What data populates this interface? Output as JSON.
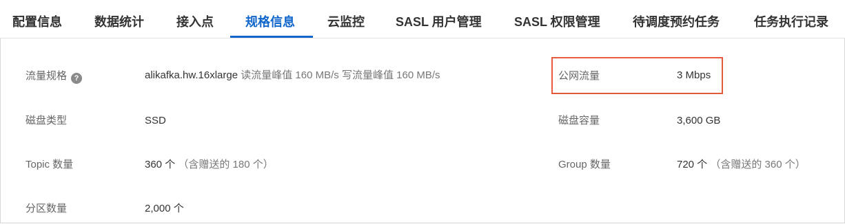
{
  "tabs": [
    {
      "label": "配置信息"
    },
    {
      "label": "数据统计"
    },
    {
      "label": "接入点"
    },
    {
      "label": "规格信息"
    },
    {
      "label": "云监控"
    },
    {
      "label": "SASL 用户管理"
    },
    {
      "label": "SASL 权限管理"
    },
    {
      "label": "待调度预约任务"
    },
    {
      "label": "任务执行记录"
    }
  ],
  "active_tab": "规格信息",
  "specs": {
    "flow_spec": {
      "label": "流量规格",
      "instance": "alikafka.hw.16xlarge",
      "detail": "读流量峰值 160 MB/s 写流量峰值 160 MB/s"
    },
    "public_flow": {
      "label": "公网流量",
      "value": "3 Mbps"
    },
    "disk_type": {
      "label": "磁盘类型",
      "value": "SSD"
    },
    "disk_capacity": {
      "label": "磁盘容量",
      "value": "3,600 GB"
    },
    "topic_count": {
      "label": "Topic 数量",
      "value": "360 个",
      "note": "（含赠送的 180 个）"
    },
    "group_count": {
      "label": "Group 数量",
      "value": "720 个",
      "note": "（含赠送的 360 个）"
    },
    "partition_count": {
      "label": "分区数量",
      "value": "2,000 个"
    }
  },
  "icons": {
    "help": "help-icon"
  },
  "colors": {
    "accent": "#1166cc",
    "highlight": "#e8583a"
  }
}
